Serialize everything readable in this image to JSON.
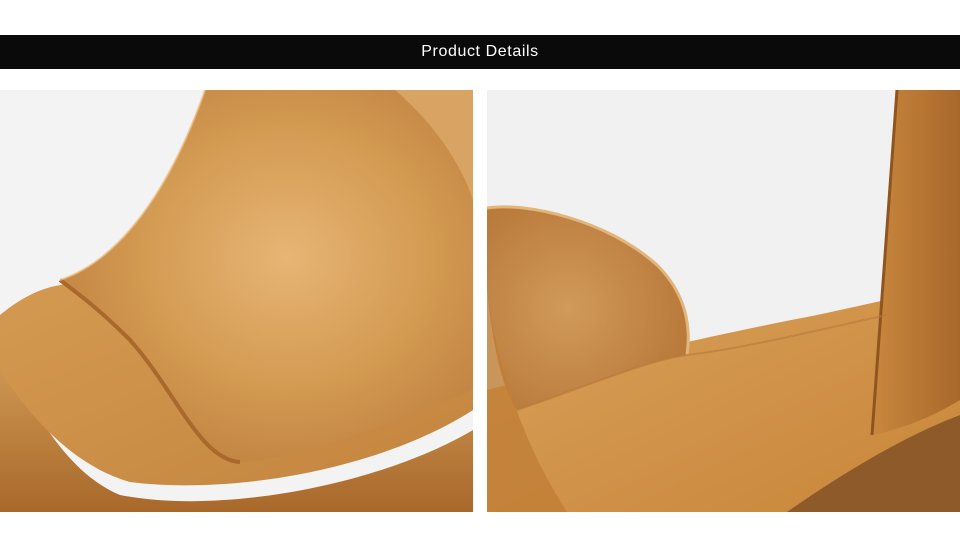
{
  "banner": {
    "title": "Product Details",
    "background_color": "#0a0a0a",
    "text_color": "#ffffff"
  },
  "photos": [
    {
      "subject": "toe-strap-closeup",
      "leather_color": "#c98a3c",
      "background_color": "#f3f3f3"
    },
    {
      "subject": "heel-and-insole-closeup",
      "leather_color": "#c98a3c",
      "background_color": "#f1f1f1"
    }
  ]
}
